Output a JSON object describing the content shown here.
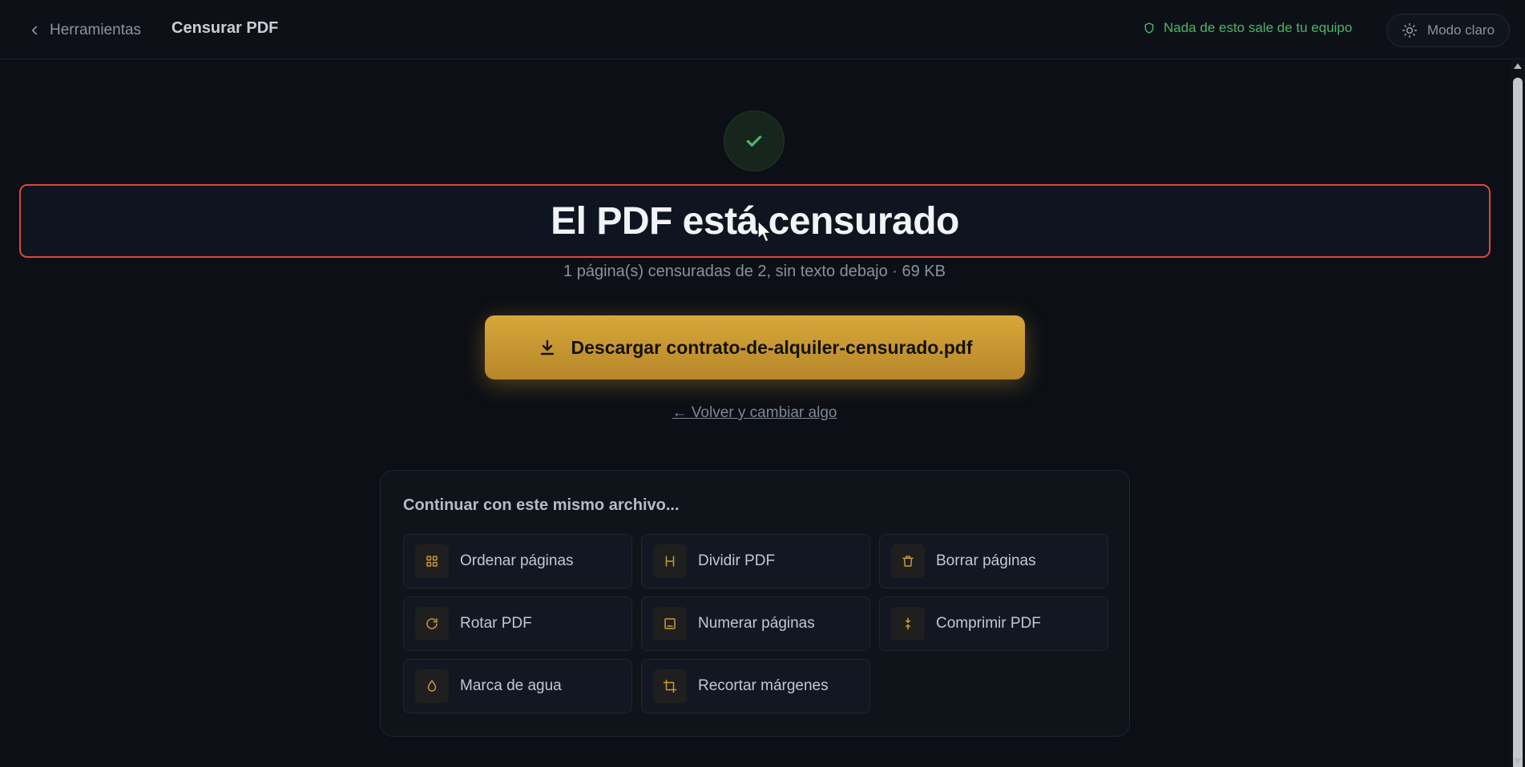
{
  "header": {
    "back_label": "Herramientas",
    "title": "Censurar PDF",
    "privacy_text": "Nada de esto sale de tu equipo",
    "mode_label": "Modo claro"
  },
  "result": {
    "headline": "El PDF está censurado",
    "subtitle": "1 página(s) censuradas de 2, sin texto debajo · 69 KB",
    "download_label": "Descargar contrato-de-alquiler-censurado.pdf",
    "go_back_label": "← Volver y cambiar algo"
  },
  "continue_panel": {
    "title": "Continuar con este mismo archivo...",
    "tools": [
      {
        "label": "Ordenar páginas",
        "icon": "grid-icon"
      },
      {
        "label": "Dividir PDF",
        "icon": "split-icon"
      },
      {
        "label": "Borrar páginas",
        "icon": "trash-icon"
      },
      {
        "label": "Rotar PDF",
        "icon": "rotate-icon"
      },
      {
        "label": "Numerar páginas",
        "icon": "page-number-icon"
      },
      {
        "label": "Comprimir PDF",
        "icon": "compress-icon"
      },
      {
        "label": "Marca de agua",
        "icon": "droplet-icon"
      },
      {
        "label": "Recortar márgenes",
        "icon": "crop-icon"
      }
    ]
  },
  "colors": {
    "accent": "#d6a73a",
    "success": "#4fb36a",
    "highlight_border": "#e0463a",
    "background": "#0c0f15"
  }
}
